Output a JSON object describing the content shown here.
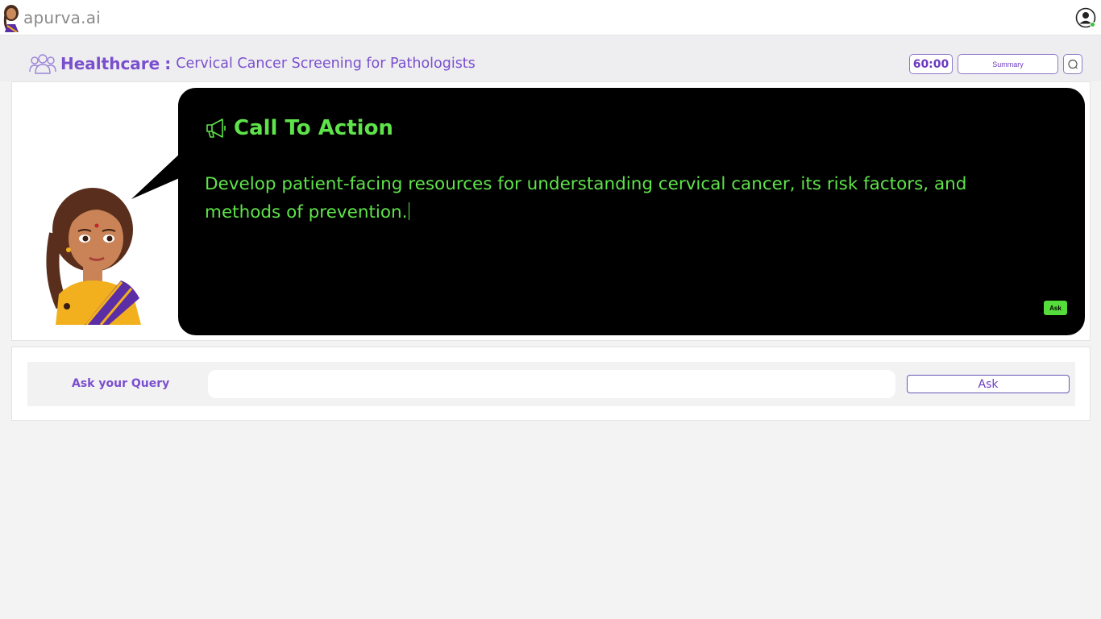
{
  "app": {
    "name": "apurva.ai"
  },
  "header": {
    "category": "Healthcare",
    "separator": ":",
    "title": "Cervical Cancer Screening for Pathologists",
    "timer": "60:00",
    "summary_label": "Summary"
  },
  "content": {
    "cta_title": "Call To Action",
    "cta_text": "Develop patient-facing resources for understanding cervical cancer, its risk factors, and methods of prevention.",
    "ask_mini_label": "Ask"
  },
  "query": {
    "label": "Ask your Query",
    "input_value": "",
    "input_placeholder": "",
    "ask_label": "Ask"
  },
  "colors": {
    "accent_purple": "#7a4fce",
    "cta_green": "#5fe34a",
    "bubble_bg": "#000000"
  },
  "icons": {
    "brand": "avatar-logo-icon",
    "profile": "user-profile-icon",
    "header": "people-group-icon",
    "cta": "megaphone-icon",
    "search": "search-icon"
  }
}
